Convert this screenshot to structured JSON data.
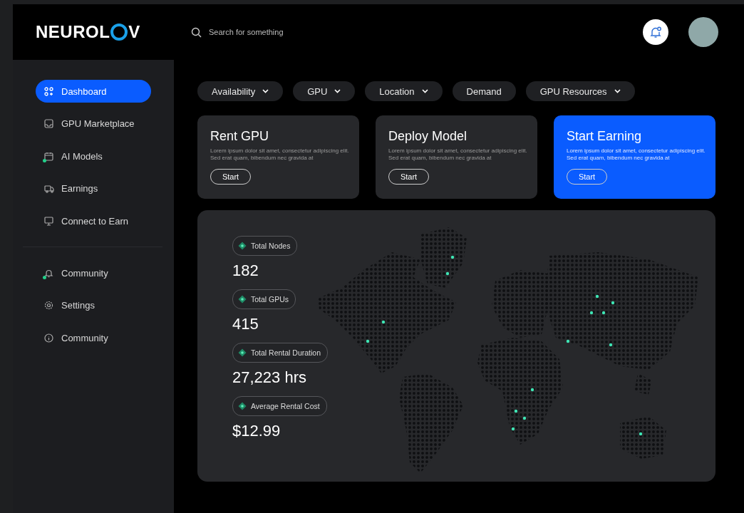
{
  "header": {
    "logo": "NEUROL",
    "logo_end": "V",
    "search": {
      "placeholder": "Search for something"
    }
  },
  "sidebar": {
    "items": [
      {
        "label": "Dashboard",
        "selected": true,
        "dot": false
      },
      {
        "label": "GPU Marketplace",
        "selected": false,
        "dot": false
      },
      {
        "label": "AI Models",
        "selected": false,
        "dot": true
      },
      {
        "label": "Earnings",
        "selected": false,
        "dot": false
      },
      {
        "label": "Connect to Earn",
        "selected": false,
        "dot": false
      }
    ],
    "bottom_items": [
      {
        "label": "Community",
        "selected": false,
        "dot": true
      },
      {
        "label": "Settings",
        "selected": false,
        "dot": false
      },
      {
        "label": "Community",
        "selected": false,
        "dot": false
      }
    ]
  },
  "filters": [
    {
      "label": "Availability",
      "dropdown": true
    },
    {
      "label": "GPU",
      "dropdown": true
    },
    {
      "label": "Location",
      "dropdown": true
    },
    {
      "label": "Demand",
      "dropdown": false
    },
    {
      "label": "GPU Resources",
      "dropdown": true
    }
  ],
  "cards": [
    {
      "title": "Rent GPU",
      "text": "Lorem ipsum dolor sit amet, consectetur adipiscing elit. Sed erat quam, bibendum nec gravida at",
      "button": "Start",
      "highlighted": false
    },
    {
      "title": "Deploy Model",
      "text": "Lorem ipsum dolor sit amet, consectetur adipiscing elit. Sed erat quam, bibendum nec gravida at",
      "button": "Start",
      "highlighted": false
    },
    {
      "title": "Start Earning",
      "text": "Lorem ipsum dolor sit amet, consectetur adipiscing elit. Sed erat quam, bibendum nec gravida at",
      "button": "Start",
      "highlighted": true
    }
  ],
  "stats": [
    {
      "label": "Total Nodes",
      "value": "182"
    },
    {
      "label": "Total GPUs",
      "value": "415"
    },
    {
      "label": "Total Rental Duration",
      "value": "27,223 hrs"
    },
    {
      "label": "Average Rental Cost",
      "value": "$12.99"
    }
  ]
}
